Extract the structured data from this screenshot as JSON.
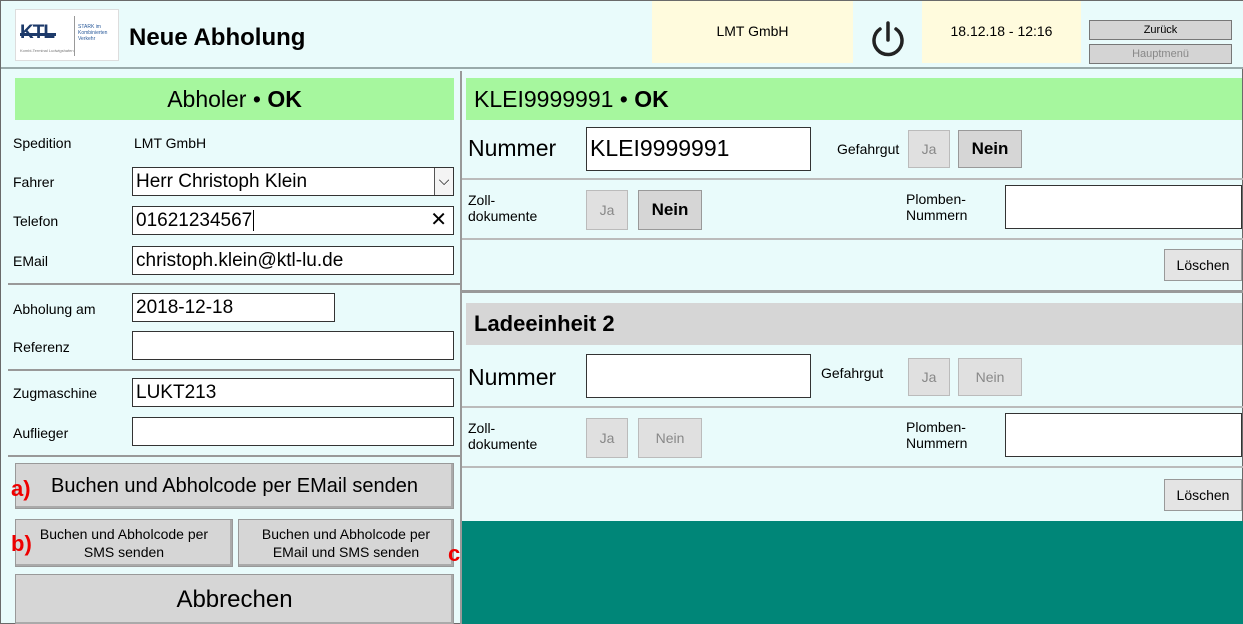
{
  "header": {
    "logo_text": "KTL",
    "logo_tagline": "STARK im Kombinierten Verkehr",
    "logo_sub": "Kombi-Terminal Ludwigshafen",
    "title": "Neue Abholung",
    "company": "LMT GmbH",
    "datetime": "18.12.18 - 12:16",
    "back_label": "Zurück",
    "main_menu_label": "Hauptmenü"
  },
  "abholer": {
    "title": "Abholer",
    "status": "OK",
    "spedition_label": "Spedition",
    "spedition_value": "LMT GmbH",
    "fahrer_label": "Fahrer",
    "fahrer_value": "Herr Christoph Klein",
    "telefon_label": "Telefon",
    "telefon_value": "01621234567",
    "email_label": "EMail",
    "email_value": "christoph.klein@ktl-lu.de",
    "abholung_label": "Abholung am",
    "abholung_value": "2018-12-18",
    "referenz_label": "Referenz",
    "referenz_value": "",
    "zugmaschine_label": "Zugmaschine",
    "zugmaschine_value": "LUKT213",
    "auflieger_label": "Auflieger",
    "auflieger_value": ""
  },
  "actions": {
    "book_email": "Buchen und Abholcode per EMail senden",
    "book_sms_1": "Buchen und Abholcode per",
    "book_sms_2": "SMS senden",
    "book_both_1": "Buchen und Abholcode per",
    "book_both_2": "EMail und SMS senden",
    "cancel": "Abbrechen",
    "mark_a": "a)",
    "mark_b": "b)",
    "mark_c": "c)"
  },
  "unit1": {
    "title": "KLEI9999991",
    "status": "OK",
    "nummer_label": "Nummer",
    "nummer_value": "KLEI9999991",
    "gefahrgut_label": "Gefahrgut",
    "ja": "Ja",
    "nein": "Nein",
    "zoll_label_1": "Zoll-",
    "zoll_label_2": "dokumente",
    "plomben_label_1": "Plomben-",
    "plomben_label_2": "Nummern",
    "plomben_value": "",
    "delete": "Löschen"
  },
  "unit2": {
    "title": "Ladeeinheit 2",
    "nummer_label": "Nummer",
    "nummer_value": "",
    "gefahrgut_label": "Gefahrgut",
    "ja": "Ja",
    "nein": "Nein",
    "zoll_label_1": "Zoll-",
    "zoll_label_2": "dokumente",
    "plomben_label_1": "Plomben-",
    "plomben_label_2": "Nummern",
    "plomben_value": "",
    "delete": "Löschen"
  },
  "colors": {
    "ok_bar": "#a6f79e",
    "panel_bg": "#e9fbfb",
    "yellow_box": "#fffbdd",
    "teal": "#008678"
  }
}
